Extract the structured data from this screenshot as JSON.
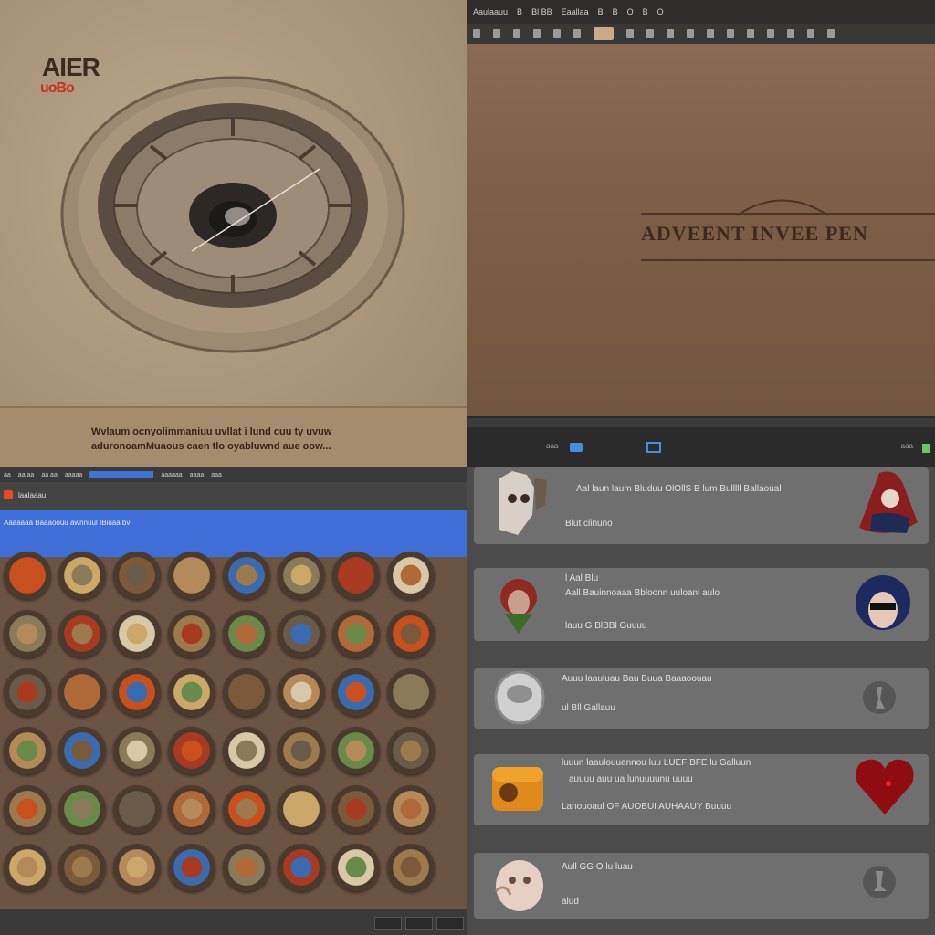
{
  "top_left": {
    "logo_line1": "AIER",
    "logo_line2": "uoBo",
    "caption_line1": "Wvlaum ocnyolimmaniuu uvllat i lund cuu ty uvuw",
    "caption_line2": "aduronoamMuaous caen tlo oyabluwnd aue oow..."
  },
  "top_right": {
    "menu": [
      "Aaulaauu",
      "B",
      "Bl BB",
      "Eaallaa",
      "B",
      "B",
      "O",
      "B",
      "O"
    ],
    "title": "ADVEENT INVEE PEN",
    "status_label": "aaa",
    "status_right_label": "aaa",
    "accent_color": "#4a8fd6"
  },
  "bottom_left": {
    "menu": [
      "aa",
      "aa aa",
      "aa aa",
      "aaaaa",
      "aaaaaa",
      "aaaa",
      "aaa"
    ],
    "address": "laalaaau",
    "banner_line": "Aaaaaaa Baaaoouu awnnuul IBiuaa bv",
    "accent_color": "#3f6fd6"
  },
  "bottom_right": {
    "cards": [
      {
        "line1": "Aal laun laum Bluduu OlOllS B lum Bulllll Ballaoual",
        "line2": "Blut clinuno"
      },
      {
        "line1": "l Aal Blu",
        "line2": "Aall Bauinnoaaa Bbloonn uuloanl aulo",
        "line3": "lauu G BlBBl Guuuu"
      },
      {
        "line1": "Auuu laauluau Bau Buua Baaaoouau",
        "line2": "ul Bll Gallauu"
      },
      {
        "line1": "luuun laaulouuannou luu LUEF BFE lu Galluun",
        "line2": "auuuu auu ua lunuuuunu uuuu",
        "line3": "Lanouoaul OF AUOBUI AUHAAUY Buuuu"
      },
      {
        "line1": "Aull GG O lu luau",
        "line2": "alud"
      }
    ]
  }
}
